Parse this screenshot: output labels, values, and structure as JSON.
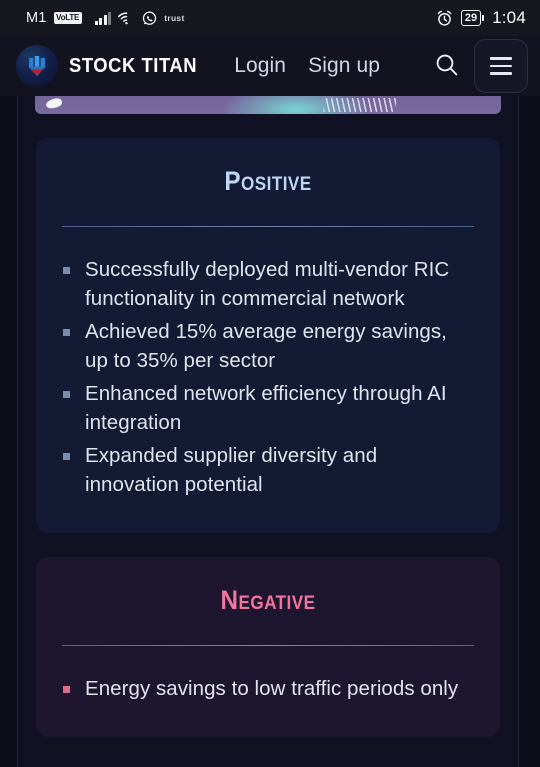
{
  "statusbar": {
    "carrier": "M1",
    "volte_badge": "VoLTE",
    "signal_icon": "signal-bars-icon",
    "wifi_icon": "wifi-icon",
    "whatsapp_icon": "whatsapp-icon",
    "trust_label": "trust",
    "alarm_icon": "alarm-clock-icon",
    "battery_percent": "29",
    "time": "1:04"
  },
  "header": {
    "logo_icon": "stock-titan-logo-icon",
    "brand": "STOCK TITAN",
    "login": "Login",
    "signup": "Sign up",
    "search_icon": "search-icon",
    "menu_icon": "hamburger-menu-icon"
  },
  "cards": {
    "positive": {
      "title": "Positive",
      "accent": "#bcd6f5",
      "bullets": [
        "Successfully deployed multi-vendor RIC functionality in commercial network",
        "Achieved 15% average energy savings, up to 35% per sector",
        "Enhanced network efficiency through AI integration",
        "Expanded supplier diversity and innovation potential"
      ]
    },
    "negative": {
      "title": "Negative",
      "accent": "#f4759c",
      "bullets": [
        "Energy savings to low traffic periods only"
      ]
    }
  }
}
